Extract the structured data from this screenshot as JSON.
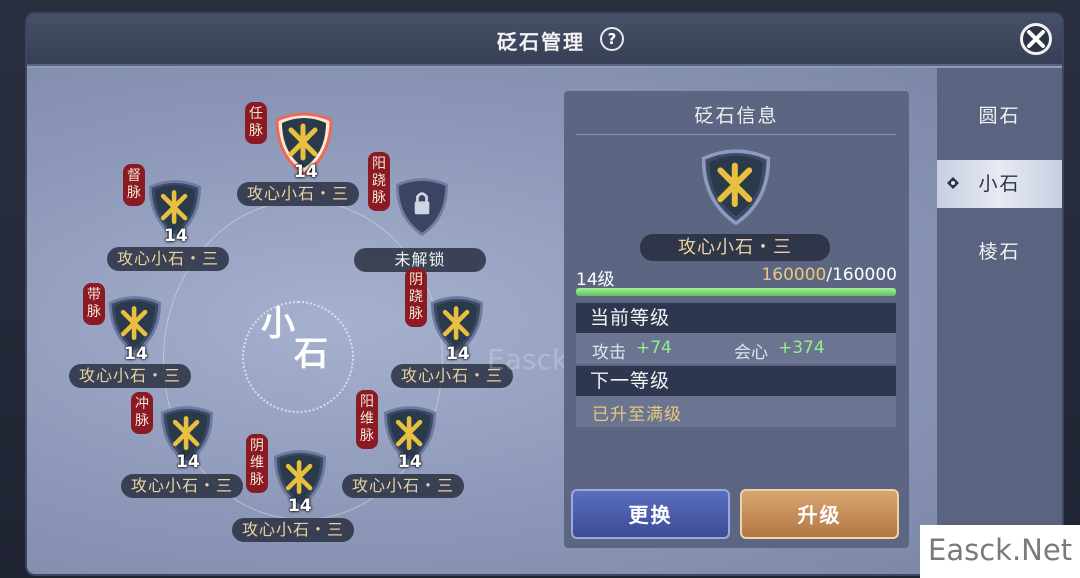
{
  "header": {
    "title": "砭石管理",
    "help_symbol": "?"
  },
  "center_label_top": "小",
  "center_label_bottom": "石",
  "slots": [
    {
      "meridian": "任脉",
      "level": "14",
      "name": "攻心小石・三"
    },
    {
      "meridian": "督脉",
      "level": "14",
      "name": "攻心小石・三"
    },
    {
      "meridian": "阳跷脉",
      "level": "",
      "name": "未解锁"
    },
    {
      "meridian": "带脉",
      "level": "14",
      "name": "攻心小石・三"
    },
    {
      "meridian": "阴跷脉",
      "level": "14",
      "name": "攻心小石・三"
    },
    {
      "meridian": "冲脉",
      "level": "14",
      "name": "攻心小石・三"
    },
    {
      "meridian": "阳维脉",
      "level": "14",
      "name": "攻心小石・三"
    },
    {
      "meridian": "阴维脉",
      "level": "14",
      "name": "攻心小石・三"
    }
  ],
  "info": {
    "title": "砭石信息",
    "name": "攻心小石・三",
    "level_text": "14级",
    "exp_current": "160000",
    "exp_max": "/160000",
    "exp_fraction": 1.0,
    "current_header": "当前等级",
    "stats": [
      {
        "label": "攻击",
        "value": "+74"
      },
      {
        "label": "会心",
        "value": "+374"
      }
    ],
    "next_header": "下一等级",
    "next_text": "已升至满级"
  },
  "buttons": {
    "swap": "更换",
    "upgrade": "升级"
  },
  "side_tabs": [
    "圆石",
    "小石",
    "棱石"
  ],
  "active_tab": "小石",
  "watermark": "Easck.Net",
  "watermark_faint": "Easck.Net",
  "colors": {
    "meridian_tag": "#8a1a24",
    "stat_green": "#8ff08a",
    "gold": "#e8c87a"
  }
}
